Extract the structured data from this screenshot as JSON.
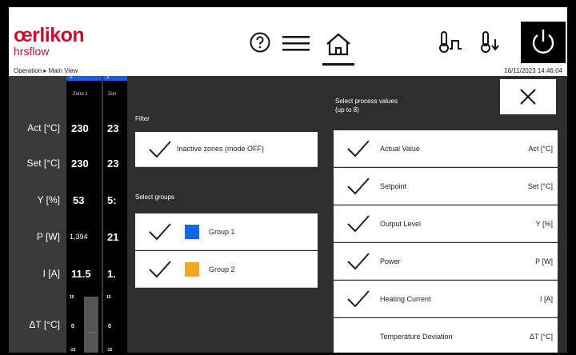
{
  "header": {
    "logo_main": "œrlikon",
    "logo_sub": "hrsflow",
    "breadcrumb": "Operation ▸ Main View",
    "datetime": "16/11/2023 14:46:04",
    "help_icon": "help-icon",
    "menu_icon": "hamburger-menu-icon",
    "home_icon": "home-icon",
    "heat_icon": "thermometer-heat-icon",
    "cool_icon": "thermometer-down-icon",
    "power_icon": "power-icon"
  },
  "rows": [
    "Act [°C]",
    "Set [°C]",
    "Y [%]",
    "P [W]",
    "I [A]",
    "ΔT [°C]"
  ],
  "zones": [
    {
      "num": "1",
      "name": "Zone 1",
      "act": "230",
      "set": "230",
      "y": "53",
      "p": "1,394",
      "i": "11.5",
      "dt_top": "15",
      "dt_mid": "0",
      "dt_bot": "-15"
    },
    {
      "num": "2",
      "name": "Zon",
      "act": "23",
      "set": "23",
      "y": "5:",
      "p": "21",
      "i": "1.",
      "dt_top": "15",
      "dt_mid": "0",
      "dt_bot": "-15"
    }
  ],
  "filter": {
    "title": "Filter",
    "inactive_label": "Inactive zones (mode OFF)",
    "groups_title": "Select groups",
    "groups": [
      {
        "label": "Group 1",
        "color": "#1565e0"
      },
      {
        "label": "Group 2",
        "color": "#f0a81e"
      }
    ]
  },
  "process": {
    "title_line1": "Select process values",
    "title_line2": "(up to 8)",
    "items": [
      {
        "label": "Actual Value",
        "abbr": "Act [°C]",
        "checked": true
      },
      {
        "label": "Setpoint",
        "abbr": "Set [°C]",
        "checked": true
      },
      {
        "label": "Output Level",
        "abbr": "Y [%]",
        "checked": true
      },
      {
        "label": "Power",
        "abbr": "P [W]",
        "checked": true
      },
      {
        "label": "Heating Current",
        "abbr": "I [A]",
        "checked": true
      },
      {
        "label": "Temperature Deviation",
        "abbr": "ΔT [°C]",
        "checked": false
      }
    ]
  },
  "close_icon": "close-icon"
}
